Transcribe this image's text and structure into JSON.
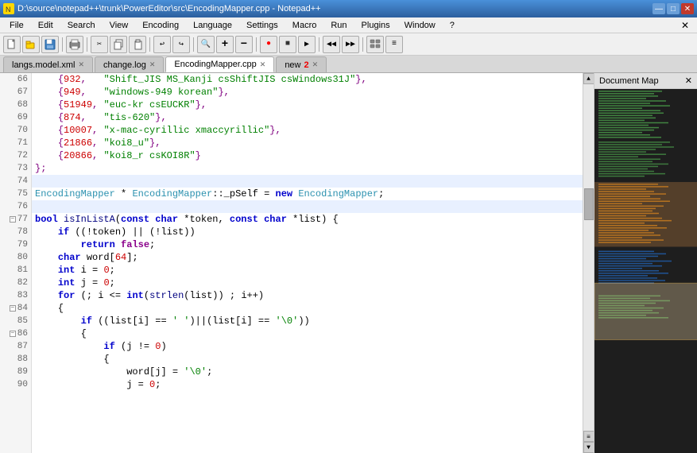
{
  "titlebar": {
    "title": "D:\\source\\notepad++\\trunk\\PowerEditor\\src\\EncodingMapper.cpp - Notepad++",
    "icon": "N",
    "buttons": {
      "minimize": "—",
      "maximize": "□",
      "close": "✕"
    }
  },
  "menubar": {
    "items": [
      "File",
      "Edit",
      "Search",
      "View",
      "Encoding",
      "Language",
      "Settings",
      "Macro",
      "Run",
      "Plugins",
      "Window",
      "?"
    ],
    "close": "✕"
  },
  "tabs": [
    {
      "label": "langs.model.xml",
      "active": false,
      "modified": false
    },
    {
      "label": "change.log",
      "active": false,
      "modified": false
    },
    {
      "label": "EncodingMapper.cpp",
      "active": true,
      "modified": false
    },
    {
      "label": "new",
      "active": false,
      "modified": true,
      "num": "2"
    }
  ],
  "docmap": {
    "title": "Document Map",
    "close": "✕"
  },
  "code": {
    "lines": [
      {
        "num": "66",
        "fold": false,
        "highlighted": false,
        "content": "    {932,   \"Shift_JIS MS_Kanji csShiftJIS csWindows31J\"},"
      },
      {
        "num": "67",
        "fold": false,
        "highlighted": false,
        "content": "    {949,   \"windows-949 korean\"},"
      },
      {
        "num": "68",
        "fold": false,
        "highlighted": false,
        "content": "    {51949, \"euc-kr csEUCKR\"},"
      },
      {
        "num": "69",
        "fold": false,
        "highlighted": false,
        "content": "    {874,   \"tis-620\"},"
      },
      {
        "num": "70",
        "fold": false,
        "highlighted": false,
        "content": "    {10007, \"x-mac-cyrillic xmaccyrillic\"},"
      },
      {
        "num": "71",
        "fold": false,
        "highlighted": false,
        "content": "    {21866, \"koi8_u\"},"
      },
      {
        "num": "72",
        "fold": false,
        "highlighted": false,
        "content": "    {20866, \"koi8_r csKOI8R\"}"
      },
      {
        "num": "73",
        "fold": false,
        "highlighted": false,
        "content": "};"
      },
      {
        "num": "74",
        "fold": false,
        "highlighted": true,
        "content": ""
      },
      {
        "num": "75",
        "fold": false,
        "highlighted": false,
        "content": "EncodingMapper * EncodingMapper::_pSelf = new EncodingMapper;"
      },
      {
        "num": "76",
        "fold": false,
        "highlighted": true,
        "content": ""
      },
      {
        "num": "77",
        "fold": true,
        "highlighted": false,
        "content": "bool isInListA(const char *token, const char *list) {"
      },
      {
        "num": "78",
        "fold": false,
        "highlighted": false,
        "content": "    if ((!token) || (!list))"
      },
      {
        "num": "79",
        "fold": false,
        "highlighted": false,
        "content": "        return false;"
      },
      {
        "num": "80",
        "fold": false,
        "highlighted": false,
        "content": "    char word[64];"
      },
      {
        "num": "81",
        "fold": false,
        "highlighted": false,
        "content": "    int i = 0;"
      },
      {
        "num": "82",
        "fold": false,
        "highlighted": false,
        "content": "    int j = 0;"
      },
      {
        "num": "83",
        "fold": false,
        "highlighted": false,
        "content": "    for (; i <= int(strlen(list)) ; i++)"
      },
      {
        "num": "84",
        "fold": true,
        "highlighted": false,
        "content": "    {"
      },
      {
        "num": "85",
        "fold": false,
        "highlighted": false,
        "content": "        if ((list[i] == ' ')||(list[i] == '\\0'))"
      },
      {
        "num": "86",
        "fold": true,
        "highlighted": false,
        "content": "        {"
      },
      {
        "num": "87",
        "fold": false,
        "highlighted": false,
        "content": "            if (j != 0)"
      },
      {
        "num": "88",
        "fold": false,
        "highlighted": false,
        "content": "            {"
      },
      {
        "num": "89",
        "fold": false,
        "highlighted": false,
        "content": "                word[j] = '\\0';"
      },
      {
        "num": "90",
        "fold": false,
        "highlighted": false,
        "content": "                j = 0;"
      }
    ]
  }
}
